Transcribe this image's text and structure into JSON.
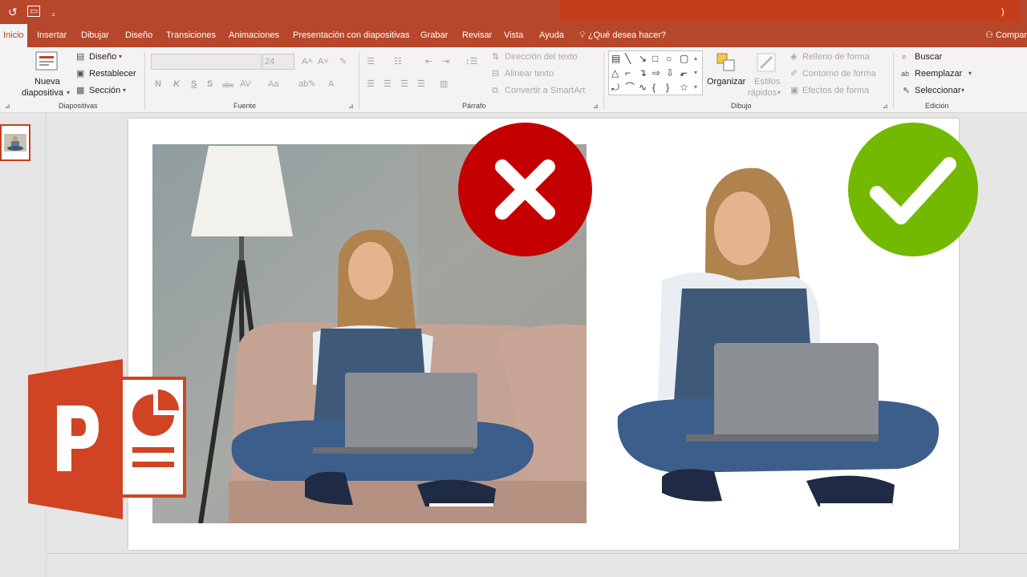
{
  "title_bar": {
    "undo_icon": "undo-icon",
    "present_icon": "present-from-start-icon",
    "customize_icon": "customize-qat-icon"
  },
  "tabs": [
    {
      "label": "Inicio",
      "active": true
    },
    {
      "label": "Insertar"
    },
    {
      "label": "Dibujar"
    },
    {
      "label": "Diseño"
    },
    {
      "label": "Transiciones"
    },
    {
      "label": "Animaciones"
    },
    {
      "label": "Presentación con diapositivas"
    },
    {
      "label": "Grabar"
    },
    {
      "label": "Revisar"
    },
    {
      "label": "Vista"
    },
    {
      "label": "Ayuda"
    }
  ],
  "tell_me": "¿Qué desea hacer?",
  "share": "Compar",
  "ribbon": {
    "diapositivas": {
      "group_label": "Diapositivas",
      "nueva_line1": "Nueva",
      "nueva_line2": "diapositiva",
      "diseno": "Diseño",
      "restablecer": "Restablecer",
      "seccion": "Sección"
    },
    "fuente": {
      "group_label": "Fuente",
      "size": "24",
      "bold": "N",
      "italic": "K",
      "underline": "S",
      "shadow": "S",
      "strike": "abc",
      "spacing": "AV",
      "case": "Aa"
    },
    "parrafo": {
      "group_label": "Párrafo",
      "direccion": "Dirección del texto",
      "alinear": "Alinear texto",
      "convertir": "Convertir a SmartArt"
    },
    "dibujo": {
      "group_label": "Dibujo",
      "organizar": "Organizar",
      "estilos_line1": "Estilos",
      "estilos_line2": "rápidos",
      "relleno": "Relleno de forma",
      "contorno": "Contorno de forma",
      "efectos": "Efectos de forma"
    },
    "edicion": {
      "group_label": "Edición",
      "buscar": "Buscar",
      "reemplazar": "Reemplazar",
      "seleccionar": "Seleccionar"
    }
  },
  "colors": {
    "brand": "#b7472a",
    "ribbon_bg": "#f3f3f3",
    "x_badge": "#c50000",
    "check_badge": "#72b900",
    "logo_orange": "#d04423"
  },
  "slide": {
    "badge_bad": "x-icon",
    "badge_good": "checkmark-icon"
  }
}
